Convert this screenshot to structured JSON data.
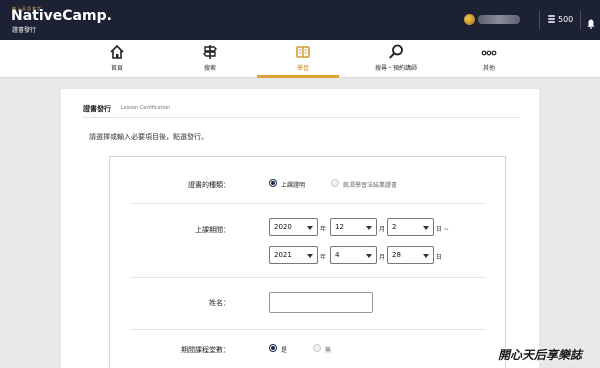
{
  "header": {
    "brand_tagline": "線上英語會話",
    "brand": "NativeCamp.",
    "brand_subtitle": "證書發行",
    "coins": "500",
    "colors": {
      "background": "#1c2233",
      "accent": "#e0a236"
    }
  },
  "nav": {
    "items": [
      {
        "label": "首頁",
        "icon": "home-icon"
      },
      {
        "label": "搜索",
        "icon": "signpost-icon"
      },
      {
        "label": "學習",
        "icon": "book-icon",
        "active": true
      },
      {
        "label": "搜尋・預約講師",
        "icon": "magnifier-icon"
      },
      {
        "label": "其他",
        "icon": "more-dots-icon"
      }
    ]
  },
  "panel": {
    "title": "證書發行",
    "title_en": "Lesson Certification",
    "intro": "請選擇或輸入必要項目後，點選發行。"
  },
  "form": {
    "certificate_type": {
      "label": "證書的種類：",
      "options": [
        {
          "label": "上課證明",
          "checked": true
        },
        {
          "label": "飢渴學習法結業證書",
          "checked": false,
          "disabled": true
        }
      ]
    },
    "period": {
      "label": "上課期間：",
      "from": {
        "year": "2020",
        "month": "12",
        "day": "2"
      },
      "to": {
        "year": "2021",
        "month": "4",
        "day": "28"
      },
      "year_unit": "年",
      "month_unit": "月",
      "day_unit": "日",
      "range_sep": "日 ~"
    },
    "name": {
      "label": "姓名：",
      "value": "",
      "placeholder": ""
    },
    "include_courses": {
      "label": "期間課程堂數：",
      "options": [
        {
          "label": "是",
          "checked": true
        },
        {
          "label": "無",
          "checked": false,
          "disabled": true
        }
      ]
    }
  },
  "watermark": "開心天后享樂誌"
}
